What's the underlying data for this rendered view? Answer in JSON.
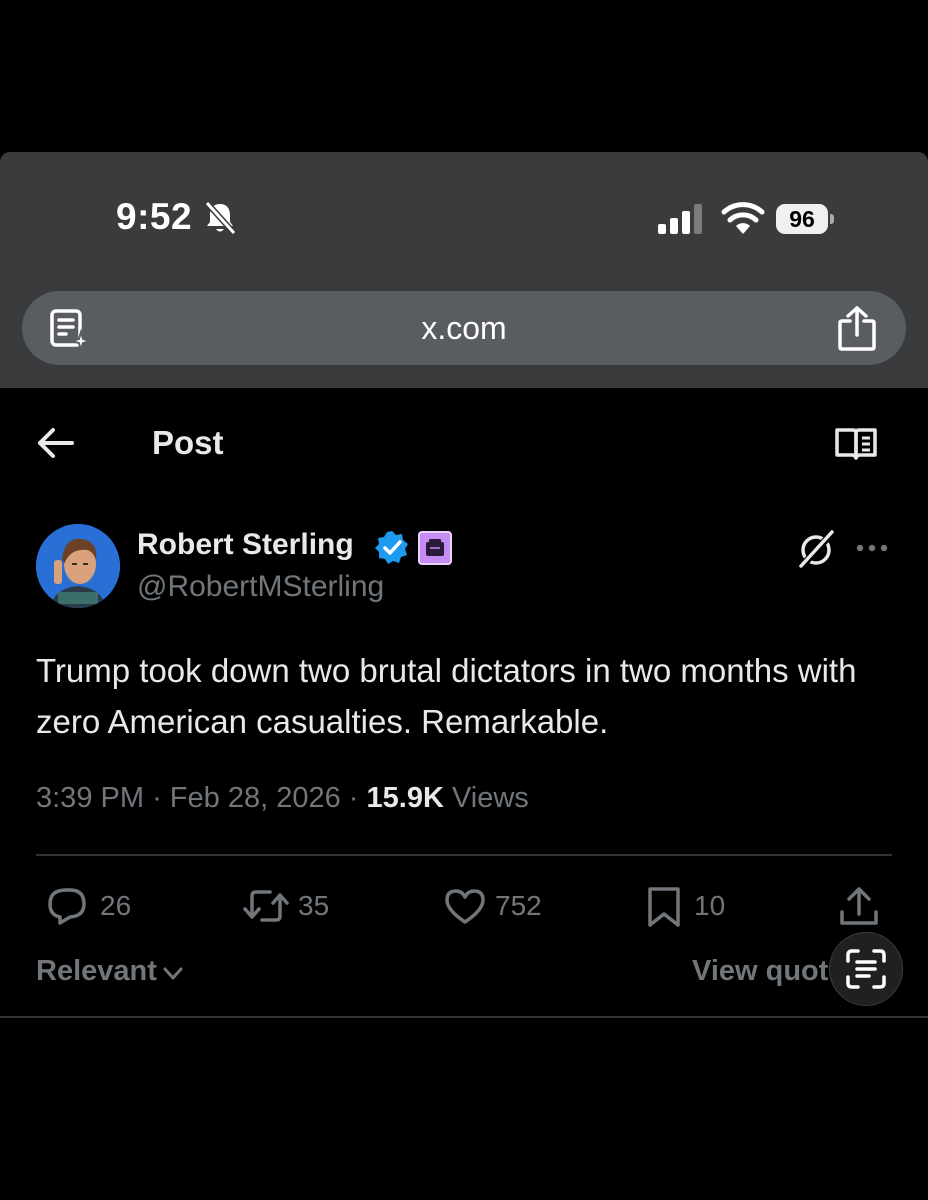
{
  "status_bar": {
    "time": "9:52",
    "battery_level": "96",
    "icons": [
      "bell-slash-icon",
      "cellular-signal-icon",
      "wifi-icon",
      "battery-icon"
    ]
  },
  "browser": {
    "url": "x.com",
    "icons": [
      "page-summary-icon",
      "share-icon"
    ]
  },
  "header": {
    "title": "Post",
    "icons": [
      "back-arrow-icon",
      "reader-mode-icon"
    ]
  },
  "post": {
    "author_name": "Robert Sterling",
    "author_handle": "@RobertMSterling",
    "verified_color": "#1d9bf0",
    "badge_color": "#c58cf3",
    "text": "Trump took down two brutal dictators in two months with zero American casualties. Remarkable.",
    "time": "3:39 PM",
    "separator": "·",
    "date": "Feb 28, 2026",
    "views_count": "15.9K",
    "views_label": "Views",
    "actions": {
      "replies": "26",
      "reposts": "35",
      "likes": "752",
      "bookmarks": "10"
    }
  },
  "replies_section": {
    "sort_label": "Relevant",
    "view_quotes_label": "View quotes"
  },
  "colors": {
    "background": "#000000",
    "browser_chrome": "#3a3b3d",
    "url_bar": "#595c60",
    "secondary_text": "#71767b",
    "primary_text": "#e7e9ea"
  }
}
